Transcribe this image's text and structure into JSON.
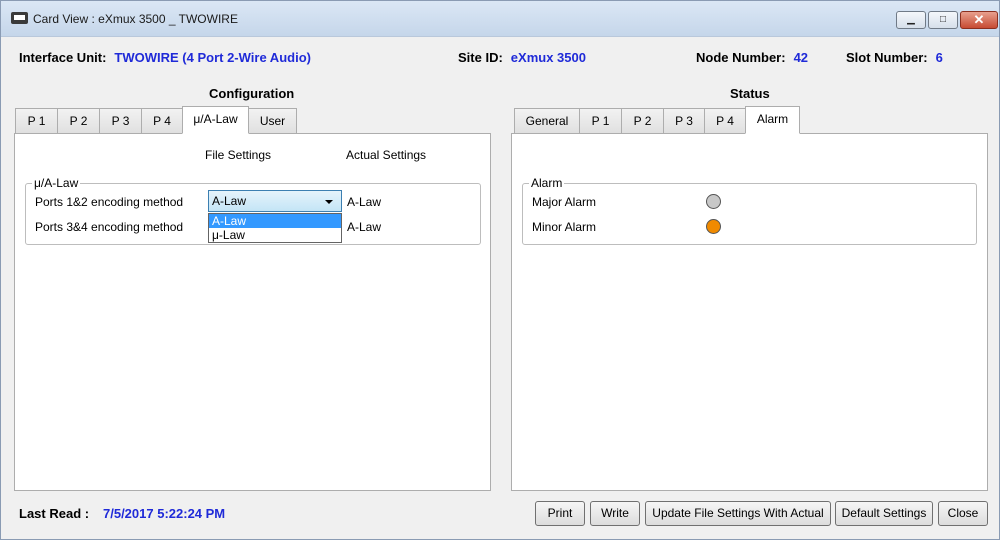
{
  "window": {
    "title": "Card View : eXmux 3500 _ TWOWIRE",
    "controls": {
      "minimize": "▁",
      "maximize": "□",
      "close": "✕"
    }
  },
  "info": {
    "interface_unit_label": "Interface Unit:",
    "interface_unit_value": "TWOWIRE (4 Port 2-Wire Audio)",
    "site_id_label": "Site ID:",
    "site_id_value": "eXmux 3500",
    "node_number_label": "Node Number:",
    "node_number_value": "42",
    "slot_number_label": "Slot Number:",
    "slot_number_value": "6"
  },
  "configuration": {
    "title": "Configuration",
    "tabs": [
      "P 1",
      "P 2",
      "P 3",
      "P 4",
      "μ/A-Law",
      "User"
    ],
    "active_tab": "μ/A-Law",
    "file_settings_header": "File Settings",
    "actual_settings_header": "Actual Settings",
    "group_label": "μ/A-Law",
    "rows": [
      {
        "label": "Ports 1&2 encoding method",
        "file_value": "A-Law",
        "actual_value": "A-Law"
      },
      {
        "label": "Ports 3&4 encoding method",
        "file_value": "",
        "actual_value": "A-Law"
      }
    ],
    "dropdown_options": [
      "A-Law",
      "μ-Law"
    ],
    "dropdown_selected": "A-Law"
  },
  "status": {
    "title": "Status",
    "tabs": [
      "General",
      "P 1",
      "P 2",
      "P 3",
      "P 4",
      "Alarm"
    ],
    "active_tab": "Alarm",
    "group_label": "Alarm",
    "alarms": [
      {
        "label": "Major Alarm",
        "color": "#c8c8c8"
      },
      {
        "label": "Minor Alarm",
        "color": "#f08a00"
      }
    ]
  },
  "footer": {
    "last_read_label": "Last Read :",
    "last_read_value": "7/5/2017 5:22:24 PM",
    "buttons": [
      "Print",
      "Write",
      "Update File Settings With Actual",
      "Default Settings",
      "Close"
    ]
  },
  "colors": {
    "value_blue": "#1f2ad8",
    "selection_blue": "#3399ff"
  }
}
